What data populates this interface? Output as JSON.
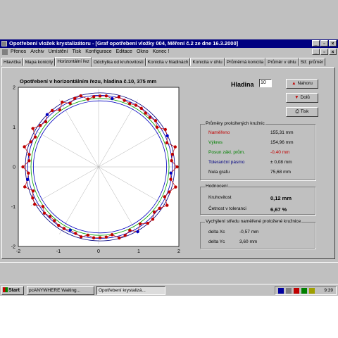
{
  "window": {
    "title": "Opotřebení vložek krystalizátoru - [Graf opotřebení vložky 004, Měření č.2 ze dne 16.3.2000]"
  },
  "menu": [
    "Přenos",
    "Archiv",
    "Umístění",
    "Tisk",
    "Konfigurace",
    "Editace",
    "Okno",
    "Konec !"
  ],
  "tabs": [
    "Hlavička",
    "Mapa konicity",
    "Horizontální řez",
    "Odchylka od kruhovitosti",
    "Konicita v hladinách",
    "Konicita v úhlu",
    "Průměrná konicita",
    "Průměr v úhlu",
    "Stř. průměr"
  ],
  "active_tab": 2,
  "plot": {
    "title": "Opotřebení v horizontálním řezu, hladina č.10, 375 mm",
    "x_ticks": [
      "-2",
      "-1",
      "0",
      "1",
      "2"
    ],
    "y_ticks": [
      "2",
      "1",
      "0",
      "-1",
      "-2"
    ]
  },
  "chart_data": {
    "type": "scatter",
    "xlim": [
      -2,
      2
    ],
    "ylim": [
      -2,
      2
    ],
    "grid": "radial spokes every 30°",
    "series": [
      {
        "color": "#c00000",
        "shape": "circle",
        "deviation": [
          0.1,
          0.05,
          -0.02,
          0.12,
          0.08,
          -0.05,
          0.06,
          0.14,
          0.02,
          -0.06,
          0.09,
          0.04,
          -0.03,
          0.11,
          0.07,
          0.0,
          0.13,
          0.05,
          -0.04,
          0.08,
          0.15,
          0.03,
          -0.02,
          0.1,
          0.06,
          0.12,
          -0.05,
          0.04,
          0.09,
          0.01,
          0.11,
          0.07,
          -0.03,
          0.13,
          0.05,
          0.08
        ]
      },
      {
        "color": "#0000c0",
        "shape": "circle"
      },
      {
        "color": "#00a000",
        "shape": "circle"
      },
      {
        "color": "#000080",
        "shape": "circle"
      }
    ]
  },
  "hladina": {
    "label": "Hladina",
    "value": "10"
  },
  "buttons": {
    "up": "Nahoru",
    "down": "Dolů",
    "print": "Tisk"
  },
  "group_diameters": {
    "title": "Průměry proložených kružnic",
    "rows": [
      {
        "label": "Naměřeno",
        "value": "155,31 mm",
        "color": "#c00000",
        "value_color": "#000000"
      },
      {
        "label": "Výkres",
        "value": "154,96 mm",
        "color": "#008000",
        "value_color": "#000000"
      },
      {
        "label": "Posun zákl. prům.",
        "value": "-0,40 mm",
        "color": "#008000",
        "value_color": "#c00000"
      },
      {
        "label": "Toleranční pásmo",
        "value": "± 0,08 mm",
        "color": "#000080",
        "value_color": "#000000"
      },
      {
        "label": "Nula grafu",
        "value": "75,68 mm",
        "color": "#000000",
        "value_color": "#000000"
      }
    ]
  },
  "group_eval": {
    "title": "Hodnocení",
    "rows": [
      {
        "label": "Kruhovitost",
        "value": "0,12 mm"
      },
      {
        "label": "Četnost v toleranci",
        "value": "6,67 %"
      }
    ]
  },
  "group_center": {
    "title": "Vychýlení středu naměřené proložené kružnice",
    "rows": [
      {
        "label": "delta Xc",
        "value": "-0,57 mm"
      },
      {
        "label": "delta Yc",
        "value": "3,60 mm"
      }
    ]
  },
  "taskbar": {
    "start": "Start",
    "tasks": [
      "pcANYWHERE Waiting...",
      "Opotřebení krystalizá..."
    ],
    "clock": "9:39"
  }
}
